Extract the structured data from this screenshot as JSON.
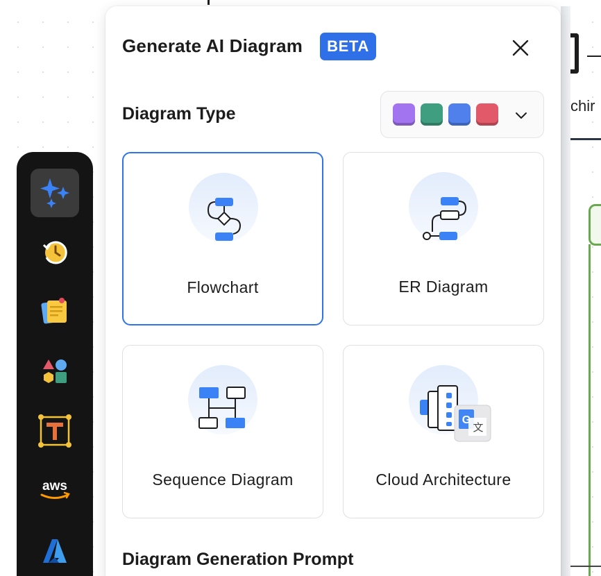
{
  "canvas": {
    "partial_text": "chir"
  },
  "toolbar": {
    "items": [
      {
        "name": "ai-sparkle",
        "icon": "sparkle-icon",
        "active": true
      },
      {
        "name": "history",
        "icon": "clock-history-icon",
        "active": false
      },
      {
        "name": "sticky-note",
        "icon": "sticky-note-icon",
        "active": false
      },
      {
        "name": "shapes",
        "icon": "shapes-icon",
        "active": false
      },
      {
        "name": "text",
        "icon": "text-icon",
        "active": false
      },
      {
        "name": "aws",
        "icon": "aws-logo-icon",
        "active": false
      },
      {
        "name": "azure",
        "icon": "azure-logo-icon",
        "active": false
      }
    ],
    "aws_label": "aws"
  },
  "panel": {
    "title": "Generate AI Diagram",
    "badge": "BETA",
    "diagram_type_label": "Diagram Type",
    "palette": {
      "swatches": [
        "#a374f0",
        "#3f9e7f",
        "#4f80ec",
        "#e2596a"
      ]
    },
    "cards": [
      {
        "label": "Flowchart",
        "icon": "flowchart-icon",
        "selected": true
      },
      {
        "label": "ER Diagram",
        "icon": "er-diagram-icon",
        "selected": false
      },
      {
        "label": "Sequence Diagram",
        "icon": "sequence-diagram-icon",
        "selected": false
      },
      {
        "label": "Cloud Architecture",
        "icon": "cloud-architecture-icon",
        "selected": false
      }
    ],
    "prompt_label": "Diagram Generation Prompt"
  },
  "colors": {
    "accent": "#2f6fe8",
    "toolbar_bg": "#141414",
    "icon_blue": "#3b82f6"
  }
}
